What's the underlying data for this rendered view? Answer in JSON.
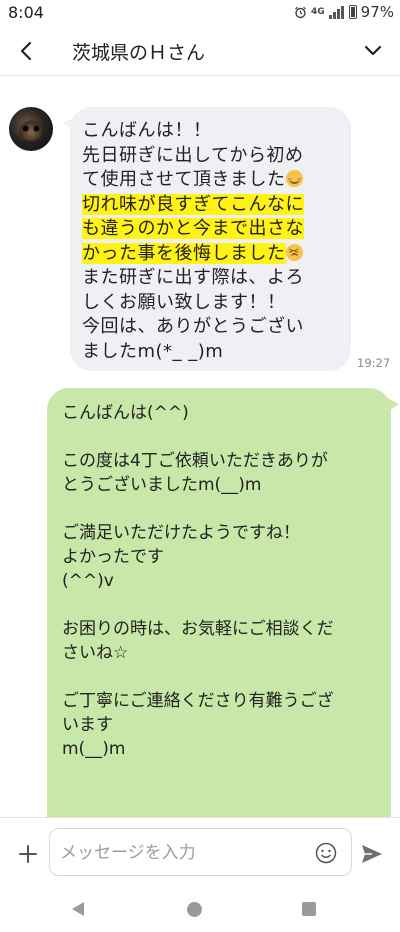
{
  "status_bar": {
    "time": "8:04",
    "network": "4G",
    "battery": "97%"
  },
  "header": {
    "title": "茨城県のＨさん"
  },
  "incoming": {
    "lines": [
      "こんばんは！！",
      "先日研ぎに出してから初め",
      "て使用させて頂きました",
      "切れ味が良すぎてこんなに",
      "も違うのかと今まで出さな",
      "かった事を後悔しました",
      "また研ぎに出す際は、よろ",
      "しくお願い致します！！",
      "今回は、ありがとうござい",
      "ましたm(*_ _)m"
    ],
    "time": "19:27"
  },
  "outgoing": {
    "lines": [
      "こんばんは(^^)",
      "",
      "この度は4丁ご依頼いただきありが",
      "とうございましたm(__)m",
      "",
      "ご満足いただけたようですね！",
      "よかったです",
      "(^^)v",
      "",
      "お困りの時は、お気軽にご相談くだ",
      "さいね☆",
      "",
      "ご丁寧にご連絡くださり有難うござ",
      "います",
      "m(__)m"
    ]
  },
  "composer": {
    "placeholder": "メッセージを入力"
  },
  "colors": {
    "incoming_bubble": "#eef0f4",
    "outgoing_bubble": "#c7e8a8",
    "highlight": "#fff214"
  }
}
